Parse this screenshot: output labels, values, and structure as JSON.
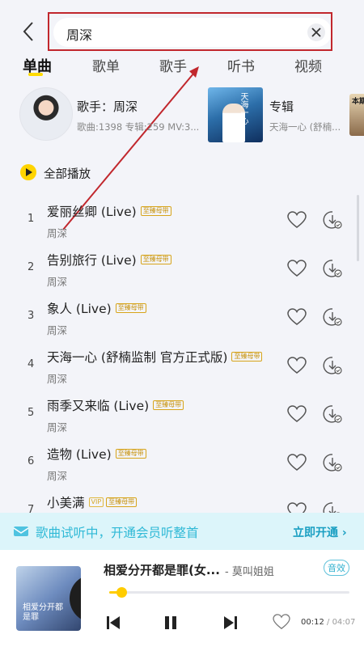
{
  "search": {
    "value": "周深"
  },
  "tabs": [
    {
      "label": "单曲",
      "active": true
    },
    {
      "label": "歌单"
    },
    {
      "label": "歌手"
    },
    {
      "label": "听书"
    },
    {
      "label": "视频"
    }
  ],
  "artist_card": {
    "name": "歌手：周深",
    "stats": "歌曲:1398  专辑:259  MV:3..."
  },
  "album_card": {
    "label": "专辑",
    "subtitle": "天海一心 (舒楠...",
    "cover_text": "天海一心"
  },
  "third_card": {
    "text": "本期"
  },
  "play_all": {
    "label": "全部播放"
  },
  "songs": [
    {
      "index": "1",
      "title": "爱丽丝卿 (Live)",
      "artist": "周深",
      "badge": "至臻母带"
    },
    {
      "index": "2",
      "title": "告别旅行 (Live)",
      "artist": "周深",
      "badge": "至臻母带"
    },
    {
      "index": "3",
      "title": "象人 (Live)",
      "artist": "周深",
      "badge": "至臻母带"
    },
    {
      "index": "4",
      "title": "天海一心 (舒楠监制 官方正式版)",
      "artist": "周深",
      "badge": "至臻母带"
    },
    {
      "index": "5",
      "title": "雨季又来临 (Live)",
      "artist": "周深",
      "badge": "至臻母带"
    },
    {
      "index": "6",
      "title": "造物 (Live)",
      "artist": "周深",
      "badge": "至臻母带"
    },
    {
      "index": "7",
      "title": "小美满",
      "artist": "",
      "vip": "VIP",
      "badge": "至臻母带"
    }
  ],
  "vip_banner": {
    "text": "歌曲试听中，开通会员听整首",
    "cta": "立即开通"
  },
  "player": {
    "title": "相爱分开都是罪(女...",
    "artist": "- 莫叫姐姐",
    "sound_effect": "音效",
    "current_time": "00:12",
    "total_time": "/ 04:07",
    "progress": 0.049,
    "cover_text": "相爱分开都是罪"
  },
  "colors": {
    "accent": "#ffd400",
    "banner_text": "#2fb9d6",
    "highlight_box": "#c1272d"
  }
}
